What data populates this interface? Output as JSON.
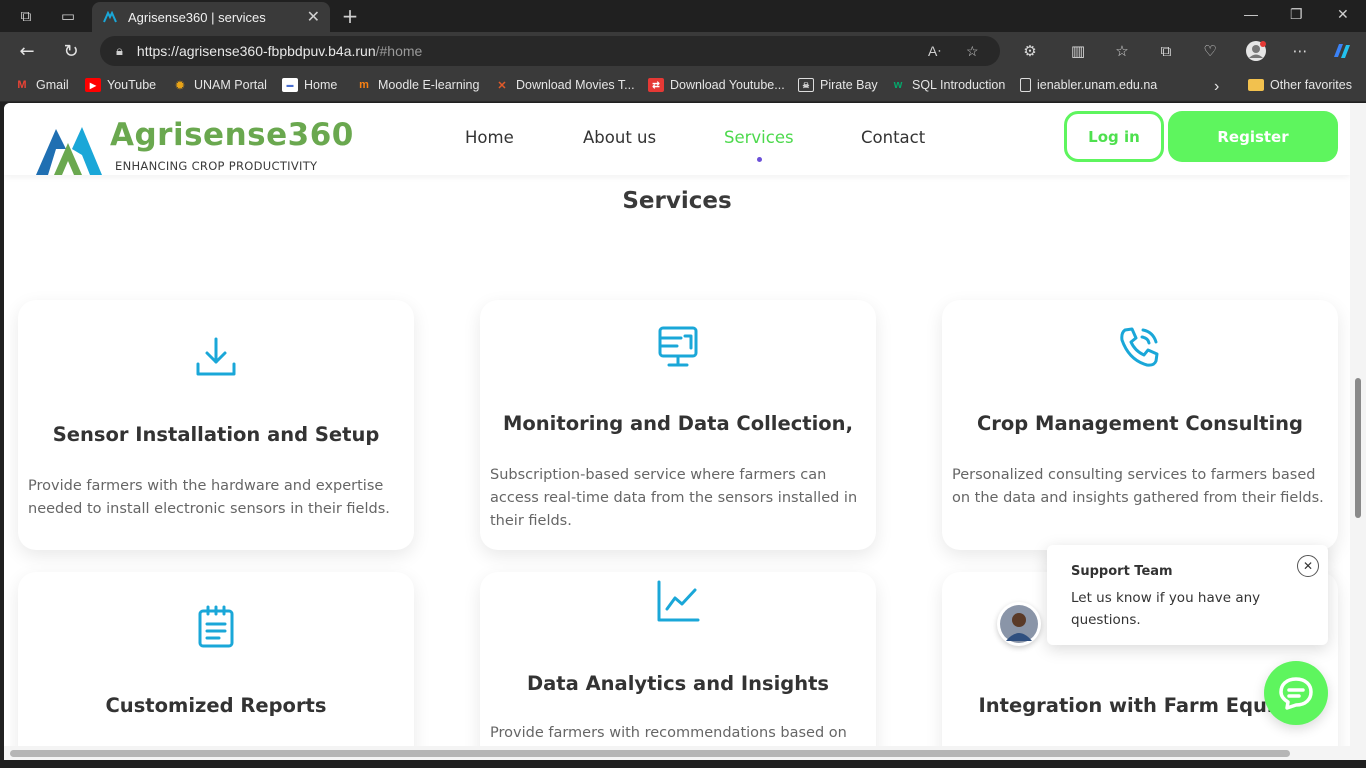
{
  "browser": {
    "tab_title": "Agrisense360 | services",
    "url_host": "https://agrisense360-fbpbdpuv.b4a.run",
    "url_path": "/#home",
    "bookmarks": [
      {
        "label": "Gmail",
        "icon": "gmail-icon",
        "color": "#ea4335"
      },
      {
        "label": "YouTube",
        "icon": "youtube-icon",
        "color": "#ff0000"
      },
      {
        "label": "UNAM Portal",
        "icon": "unam-icon",
        "color": "#e8a317"
      },
      {
        "label": "Home",
        "icon": "home-icon",
        "color": "#4a6fd0"
      },
      {
        "label": "Moodle E-learning",
        "icon": "moodle-icon",
        "color": "#f98012"
      },
      {
        "label": "Download Movies T...",
        "icon": "movies-icon",
        "color": "#e05a2a"
      },
      {
        "label": "Download Youtube...",
        "icon": "download-icon",
        "color": "#e53935"
      },
      {
        "label": "Pirate Bay",
        "icon": "pirate-icon",
        "color": "#dddddd"
      },
      {
        "label": "SQL Introduction",
        "icon": "w3-icon",
        "color": "#04aa6d"
      },
      {
        "label": "ienabler.unam.edu.na",
        "icon": "page-icon",
        "color": "#dddddd"
      }
    ],
    "other_favorites": "Other favorites"
  },
  "site": {
    "brand": "Agrisense360",
    "tagline": "ENHANCING CROP PRODUCTIVITY",
    "nav": [
      "Home",
      "About us",
      "Services",
      "Contact"
    ],
    "active_nav": "Services",
    "login": "Log in",
    "register": "Register",
    "accent": "#5ef55e",
    "icon_color": "#1aa7d8"
  },
  "services": {
    "title": "Services",
    "cards": [
      {
        "title": "Sensor Installation and Setup",
        "desc": "Provide farmers with the hardware and expertise needed to install electronic sensors in their fields.",
        "icon": "download-icon"
      },
      {
        "title": "Monitoring and Data Collection,",
        "desc": "Subscription-based service where farmers can access real-time data from the sensors installed in their fields.",
        "icon": "monitor-icon"
      },
      {
        "title": "Crop Management Consulting",
        "desc": "Personalized consulting services to farmers based on the data and insights gathered from their fields.",
        "icon": "phone-call-icon"
      },
      {
        "title": "Customized Reports",
        "desc": "",
        "icon": "notepad-icon"
      },
      {
        "title": "Data Analytics and Insights",
        "desc": "Provide farmers with recommendations based on",
        "icon": "chart-line-icon"
      },
      {
        "title": "Integration with Farm Equipn",
        "desc": "",
        "icon": ""
      }
    ]
  },
  "support": {
    "title": "Support Team",
    "message": "Let us know if you have any questions."
  }
}
